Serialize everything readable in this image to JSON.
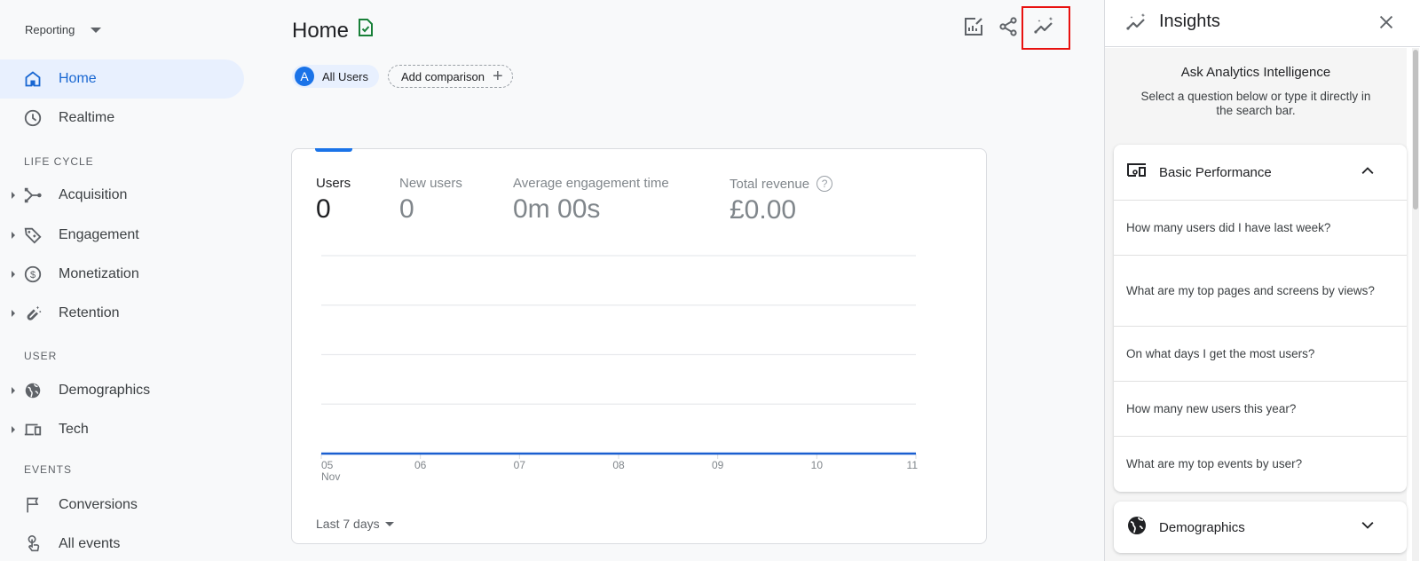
{
  "sidebar": {
    "reporting_label": "Reporting",
    "items": [
      {
        "label": "Home",
        "icon": "home-icon",
        "active": true
      },
      {
        "label": "Realtime",
        "icon": "clock-icon"
      },
      {
        "label": "Acquisition",
        "icon": "acquisition-icon"
      },
      {
        "label": "Engagement",
        "icon": "tag-icon"
      },
      {
        "label": "Monetization",
        "icon": "dollar-icon"
      },
      {
        "label": "Retention",
        "icon": "magnet-icon"
      },
      {
        "label": "Demographics",
        "icon": "globe-icon"
      },
      {
        "label": "Tech",
        "icon": "devices-icon"
      },
      {
        "label": "Conversions",
        "icon": "flag-icon"
      },
      {
        "label": "All events",
        "icon": "touch-icon"
      }
    ],
    "sections": {
      "lifecycle": "LIFE CYCLE",
      "user": "USER",
      "events": "EVENTS"
    }
  },
  "main": {
    "title": "Home",
    "segment_chip": {
      "avatar": "A",
      "label": "All Users"
    },
    "add_comparison": "Add comparison",
    "toolbar": {
      "customize": "customize-report-icon",
      "share": "share-icon",
      "insights": "insights-icon"
    },
    "metrics": [
      {
        "name": "Users",
        "value": "0"
      },
      {
        "name": "New users",
        "value": "0"
      },
      {
        "name": "Average engagement time",
        "value": "0m 00s"
      },
      {
        "name": "Total revenue",
        "value": "£0.00"
      }
    ],
    "date_range": "Last 7 days"
  },
  "chart_data": {
    "type": "line",
    "x": [
      "05",
      "06",
      "07",
      "08",
      "09",
      "10",
      "11"
    ],
    "x_sublabel": "Nov",
    "series": [
      {
        "name": "Users",
        "values": [
          0,
          0,
          0,
          0,
          0,
          0,
          0
        ],
        "color": "#1a5fd0"
      }
    ],
    "gridlines": 4,
    "grid": true,
    "title": "",
    "xlabel": "",
    "ylabel": ""
  },
  "insights": {
    "title": "Insights",
    "ask_title": "Ask Analytics Intelligence",
    "ask_subtitle": "Select a question below or type it directly in the search bar.",
    "groups": [
      {
        "label": "Basic Performance",
        "expanded": true,
        "questions": [
          "How many users did I have last week?",
          "What are my top pages and screens by views?",
          "On what days I get the most users?",
          "How many new users this year?",
          "What are my top events by user?"
        ]
      },
      {
        "label": "Demographics",
        "expanded": false
      }
    ]
  },
  "colors": {
    "accent": "#1a73e8",
    "highlight": "#e8110f",
    "active_bg": "#e8f0fe",
    "saved_green": "#188038"
  }
}
